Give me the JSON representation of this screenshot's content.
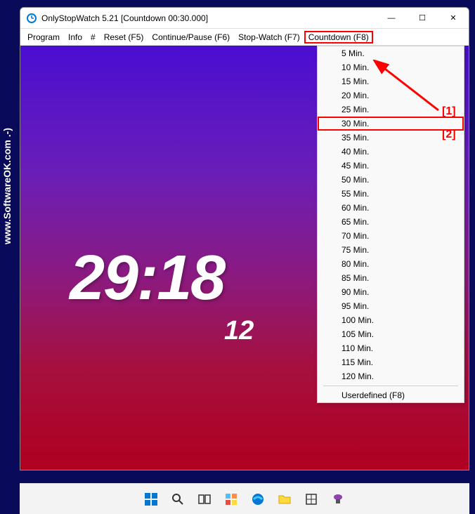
{
  "sidebar_text": "www.SoftwareOK.com  .-)",
  "titlebar": {
    "title": "OnlyStopWatch 5.21  [Countdown  00:30.000]"
  },
  "window_controls": {
    "minimize": "—",
    "maximize": "☐",
    "close": "✕"
  },
  "menubar": {
    "program": "Program",
    "info": "Info",
    "hash": "#",
    "reset": "Reset  (F5)",
    "continue_pause": "Continue/Pause  (F6)",
    "stop_watch": "Stop-Watch  (F7)",
    "countdown": "Countdown  (F8)"
  },
  "timer": {
    "main": "29:18",
    "sub": "12"
  },
  "dropdown": {
    "items": [
      "5 Min.",
      "10 Min.",
      "15 Min.",
      "20 Min.",
      "25 Min.",
      "30 Min.",
      "35 Min.",
      "40 Min.",
      "45 Min.",
      "50 Min.",
      "55 Min.",
      "60 Min.",
      "65 Min.",
      "70 Min.",
      "75 Min.",
      "80 Min.",
      "85 Min.",
      "90 Min.",
      "95 Min.",
      "100 Min.",
      "105 Min.",
      "110 Min.",
      "115 Min.",
      "120 Min."
    ],
    "userdefined": "Userdefined  (F8)"
  },
  "annotations": {
    "one": "[1]",
    "two": "[2]"
  },
  "taskbar_icons": [
    "start",
    "search",
    "taskview",
    "widgets",
    "edge",
    "explorer",
    "misc1",
    "misc2"
  ]
}
